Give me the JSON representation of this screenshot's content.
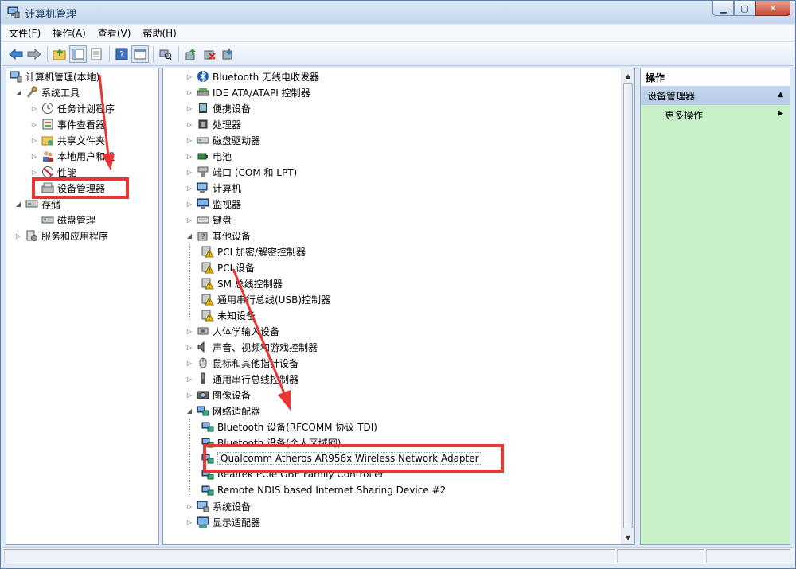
{
  "window": {
    "title": "计算机管理"
  },
  "menu": [
    "文件(F)",
    "操作(A)",
    "查看(V)",
    "帮助(H)"
  ],
  "toolbar_icons": [
    "back-icon",
    "forward-icon",
    "up-folder-icon",
    "show-hide-tree-icon",
    "properties-icon",
    "help-icon",
    "console-tree-icon",
    "scan-hardware-icon",
    "update-driver-icon",
    "disable-device-icon",
    "uninstall-device-icon"
  ],
  "left_tree": [
    {
      "label": "计算机管理(本地)",
      "icon": "computer-management-icon"
    },
    {
      "label": "系统工具",
      "icon": "system-tools-icon"
    },
    {
      "label": "任务计划程序",
      "icon": "clock-icon"
    },
    {
      "label": "事件查看器",
      "icon": "event-viewer-icon"
    },
    {
      "label": "共享文件夹",
      "icon": "shared-folder-icon"
    },
    {
      "label": "本地用户和组",
      "icon": "users-icon"
    },
    {
      "label": "性能",
      "icon": "performance-icon"
    },
    {
      "label": "设备管理器",
      "icon": "device-manager-icon"
    },
    {
      "label": "存储",
      "icon": "storage-icon"
    },
    {
      "label": "磁盘管理",
      "icon": "disk-management-icon"
    },
    {
      "label": "服务和应用程序",
      "icon": "services-icon"
    }
  ],
  "device_tree": [
    {
      "label": "Bluetooth 无线电收发器",
      "icon": "bluetooth-icon"
    },
    {
      "label": "IDE ATA/ATAPI 控制器",
      "icon": "ide-controller-icon"
    },
    {
      "label": "便携设备",
      "icon": "portable-device-icon"
    },
    {
      "label": "处理器",
      "icon": "processor-icon"
    },
    {
      "label": "磁盘驱动器",
      "icon": "disk-drive-icon"
    },
    {
      "label": "电池",
      "icon": "battery-icon"
    },
    {
      "label": "端口 (COM 和 LPT)",
      "icon": "port-icon"
    },
    {
      "label": "计算机",
      "icon": "computer-icon"
    },
    {
      "label": "监视器",
      "icon": "monitor-icon"
    },
    {
      "label": "键盘",
      "icon": "keyboard-icon"
    },
    {
      "label": "其他设备",
      "icon": "other-devices-icon"
    },
    {
      "label": "PCI 加密/解密控制器",
      "icon": "warning-device-icon"
    },
    {
      "label": "PCI 设备",
      "icon": "warning-device-icon"
    },
    {
      "label": "SM 总线控制器",
      "icon": "warning-device-icon"
    },
    {
      "label": "通用串行总线(USB)控制器",
      "icon": "warning-device-icon"
    },
    {
      "label": "未知设备",
      "icon": "warning-device-icon"
    },
    {
      "label": "人体学输入设备",
      "icon": "hid-icon"
    },
    {
      "label": "声音、视频和游戏控制器",
      "icon": "sound-icon"
    },
    {
      "label": "鼠标和其他指针设备",
      "icon": "mouse-icon"
    },
    {
      "label": "通用串行总线控制器",
      "icon": "usb-icon"
    },
    {
      "label": "图像设备",
      "icon": "imaging-icon"
    },
    {
      "label": "网络适配器",
      "icon": "network-adapter-icon"
    },
    {
      "label": "Bluetooth 设备(RFCOMM 协议 TDI)",
      "icon": "network-adapter-icon"
    },
    {
      "label": "Bluetooth 设备(个人区域网)",
      "icon": "network-adapter-icon"
    },
    {
      "label": "Qualcomm Atheros AR956x Wireless Network Adapter",
      "icon": "network-adapter-icon"
    },
    {
      "label": "Realtek PCIe GBE Family Controller",
      "icon": "network-adapter-icon"
    },
    {
      "label": "Remote NDIS based Internet Sharing Device #2",
      "icon": "network-adapter-icon"
    },
    {
      "label": "系统设备",
      "icon": "system-device-icon"
    },
    {
      "label": "显示适配器",
      "icon": "display-adapter-icon"
    }
  ],
  "actions": {
    "header": "操作",
    "section": "设备管理器",
    "more": "更多操作"
  },
  "colors": {
    "highlight": "#ea3535",
    "actions_bg": "#c7f0c7"
  }
}
